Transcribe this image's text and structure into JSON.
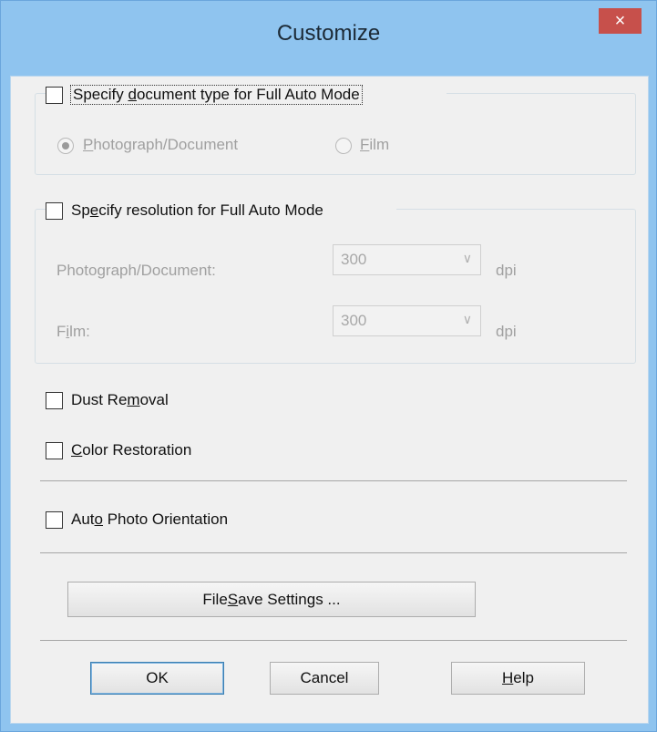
{
  "window": {
    "title": "Customize",
    "close_label": "×"
  },
  "doc_type_group": {
    "checkbox_label_pre": "Specify ",
    "checkbox_label_accel": "d",
    "checkbox_label_post": "ocument type for Full Auto Mode",
    "checked": false,
    "radio_photo_accel": "P",
    "radio_photo_rest": "hotograph/Document",
    "radio_photo_selected": true,
    "radio_film_accel": "F",
    "radio_film_rest": "ilm",
    "radio_film_selected": false
  },
  "resolution_group": {
    "checkbox_label_pre": "Sp",
    "checkbox_label_accel": "e",
    "checkbox_label_post": "cify resolution for Full Auto Mode",
    "checked": false,
    "photo_label_pre": "Photo",
    "photo_label_accel": "g",
    "photo_label_post": "raph/Document:",
    "photo_value": "300",
    "film_label_pre": "F",
    "film_label_accel": "i",
    "film_label_post": "lm:",
    "film_value": "300",
    "unit": "dpi"
  },
  "options": {
    "dust_pre": "Dust Re",
    "dust_accel": "m",
    "dust_post": "oval",
    "dust_checked": false,
    "color_accel": "C",
    "color_post": "olor Restoration",
    "color_checked": false,
    "auto_pre": "Aut",
    "auto_accel": "o",
    "auto_post": " Photo Orientation",
    "auto_checked": false
  },
  "file_save": {
    "pre": "File ",
    "accel": "S",
    "post": "ave Settings ..."
  },
  "buttons": {
    "ok": "OK",
    "cancel": "Cancel",
    "help_accel": "H",
    "help_post": "elp"
  }
}
